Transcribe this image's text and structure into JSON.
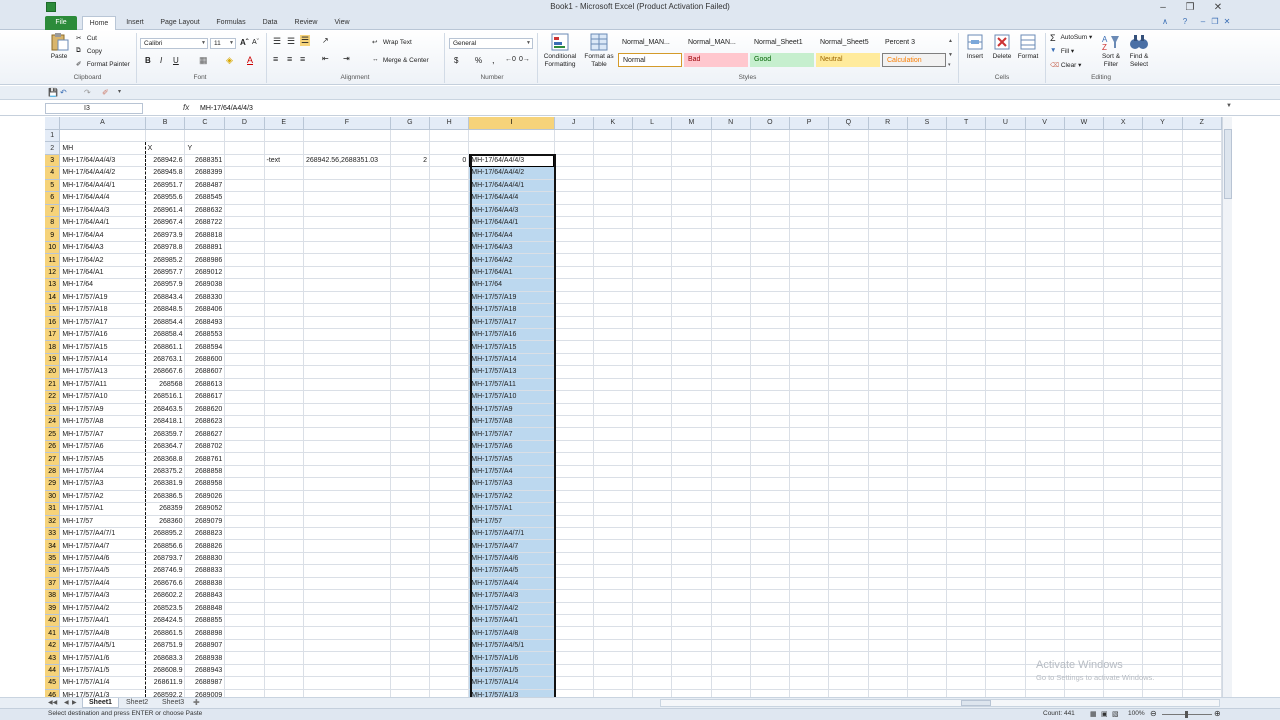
{
  "window": {
    "title": "Book1 - Microsoft Excel (Product Activation Failed)"
  },
  "ribbon_tabs": [
    "File",
    "Home",
    "Insert",
    "Page Layout",
    "Formulas",
    "Data",
    "Review",
    "View"
  ],
  "clipboard": {
    "paste": "Paste",
    "cut": "Cut",
    "copy": "Copy",
    "format_painter": "Format Painter",
    "label": "Clipboard"
  },
  "font": {
    "name": "Calibri",
    "size": "11",
    "bold": "B",
    "italic": "I",
    "underline": "U",
    "label": "Font"
  },
  "alignment": {
    "wrap_text": "Wrap Text",
    "merge_center": "Merge & Center",
    "label": "Alignment"
  },
  "number": {
    "format": "General",
    "currency": "$",
    "percent": "%",
    "comma": ",",
    "label": "Number"
  },
  "styles": {
    "conditional_formatting": "Conditional Formatting",
    "format_as_table": "Format as Table",
    "names": [
      "Normal_MAN...",
      "Normal_MAN...",
      "Normal_Sheet1",
      "Normal_Sheet5",
      "Percent 3"
    ],
    "boxes": [
      {
        "label": "Normal",
        "bg": "#ffffff",
        "fg": "#000000"
      },
      {
        "label": "Bad",
        "bg": "#ffc7ce",
        "fg": "#9c0006"
      },
      {
        "label": "Good",
        "bg": "#c6efce",
        "fg": "#006100"
      },
      {
        "label": "Neutral",
        "bg": "#ffeb9c",
        "fg": "#9c6500"
      },
      {
        "label": "Calculation",
        "bg": "#f2f2f2",
        "fg": "#fa7d00"
      }
    ],
    "label": "Styles"
  },
  "cells_group": {
    "insert": "Insert",
    "delete": "Delete",
    "format": "Format",
    "label": "Cells"
  },
  "editing": {
    "autosum": "AutoSum",
    "fill": "Fill",
    "clear": "Clear",
    "sort_filter": "Sort & Filter",
    "find_select": "Find & Select",
    "label": "Editing"
  },
  "formula_bar": {
    "name_box": "I3",
    "fx": "fx",
    "content": "MH-17/64/A4/4/3"
  },
  "columns": [
    "A",
    "B",
    "C",
    "D",
    "E",
    "F",
    "G",
    "H",
    "I",
    "J",
    "K",
    "L",
    "M",
    "N",
    "O",
    "P",
    "Q",
    "R",
    "S",
    "T",
    "U",
    "V",
    "W",
    "X",
    "Y",
    "Z"
  ],
  "header_row": {
    "A": "MH",
    "B": "X",
    "C": "Y"
  },
  "row3_extra": {
    "E": "-text",
    "F": "268942.56,2688351.03",
    "G": "2",
    "H": "0"
  },
  "rows": [
    [
      "MH-17/64/A4/4/3",
      "268942.6",
      "2688351",
      "MH-17/64/A4/4/3"
    ],
    [
      "MH-17/64/A4/4/2",
      "268945.8",
      "2688399",
      "MH-17/64/A4/4/2"
    ],
    [
      "MH-17/64/A4/4/1",
      "268951.7",
      "2688487",
      "MH-17/64/A4/4/1"
    ],
    [
      "MH-17/64/A4/4",
      "268955.6",
      "2688545",
      "MH-17/64/A4/4"
    ],
    [
      "MH-17/64/A4/3",
      "268961.4",
      "2688632",
      "MH-17/64/A4/3"
    ],
    [
      "MH-17/64/A4/1",
      "268967.4",
      "2688722",
      "MH-17/64/A4/1"
    ],
    [
      "MH-17/64/A4",
      "268973.9",
      "2688818",
      "MH-17/64/A4"
    ],
    [
      "MH-17/64/A3",
      "268978.8",
      "2688891",
      "MH-17/64/A3"
    ],
    [
      "MH-17/64/A2",
      "268985.2",
      "2688986",
      "MH-17/64/A2"
    ],
    [
      "MH-17/64/A1",
      "268957.7",
      "2689012",
      "MH-17/64/A1"
    ],
    [
      "MH-17/64",
      "268957.9",
      "2689038",
      "MH-17/64"
    ],
    [
      "MH-17/57/A19",
      "268843.4",
      "2688330",
      "MH-17/57/A19"
    ],
    [
      "MH-17/57/A18",
      "268848.5",
      "2688406",
      "MH-17/57/A18"
    ],
    [
      "MH-17/57/A17",
      "268854.4",
      "2688493",
      "MH-17/57/A17"
    ],
    [
      "MH-17/57/A16",
      "268858.4",
      "2688553",
      "MH-17/57/A16"
    ],
    [
      "MH-17/57/A15",
      "268861.1",
      "2688594",
      "MH-17/57/A15"
    ],
    [
      "MH-17/57/A14",
      "268763.1",
      "2688600",
      "MH-17/57/A14"
    ],
    [
      "MH-17/57/A13",
      "268667.6",
      "2688607",
      "MH-17/57/A13"
    ],
    [
      "MH-17/57/A11",
      "268568",
      "2688613",
      "MH-17/57/A11"
    ],
    [
      "MH-17/57/A10",
      "268516.1",
      "2688617",
      "MH-17/57/A10"
    ],
    [
      "MH-17/57/A9",
      "268463.5",
      "2688620",
      "MH-17/57/A9"
    ],
    [
      "MH-17/57/A8",
      "268418.1",
      "2688623",
      "MH-17/57/A8"
    ],
    [
      "MH-17/57/A7",
      "268359.7",
      "2688627",
      "MH-17/57/A7"
    ],
    [
      "MH-17/57/A6",
      "268364.7",
      "2688702",
      "MH-17/57/A6"
    ],
    [
      "MH-17/57/A5",
      "268368.8",
      "2688761",
      "MH-17/57/A5"
    ],
    [
      "MH-17/57/A4",
      "268375.2",
      "2688858",
      "MH-17/57/A4"
    ],
    [
      "MH-17/57/A3",
      "268381.9",
      "2688958",
      "MH-17/57/A3"
    ],
    [
      "MH-17/57/A2",
      "268386.5",
      "2689026",
      "MH-17/57/A2"
    ],
    [
      "MH-17/57/A1",
      "268359",
      "2689052",
      "MH-17/57/A1"
    ],
    [
      "MH-17/57",
      "268360",
      "2689079",
      "MH-17/57"
    ],
    [
      "MH-17/57/A4/7/1",
      "268895.2",
      "2688823",
      "MH-17/57/A4/7/1"
    ],
    [
      "MH-17/57/A4/7",
      "268856.6",
      "2688826",
      "MH-17/57/A4/7"
    ],
    [
      "MH-17/57/A4/6",
      "268793.7",
      "2688830",
      "MH-17/57/A4/6"
    ],
    [
      "MH-17/57/A4/5",
      "268746.9",
      "2688833",
      "MH-17/57/A4/5"
    ],
    [
      "MH-17/57/A4/4",
      "268676.6",
      "2688838",
      "MH-17/57/A4/4"
    ],
    [
      "MH-17/57/A4/3",
      "268602.2",
      "2688843",
      "MH-17/57/A4/3"
    ],
    [
      "MH-17/57/A4/2",
      "268523.5",
      "2688848",
      "MH-17/57/A4/2"
    ],
    [
      "MH-17/57/A4/1",
      "268424.5",
      "2688855",
      "MH-17/57/A4/1"
    ],
    [
      "MH-17/57/A4/8",
      "268861.5",
      "2688898",
      "MH-17/57/A4/8"
    ],
    [
      "MH-17/57/A4/5/1",
      "268751.9",
      "2688907",
      "MH-17/57/A4/5/1"
    ],
    [
      "MH-17/57/A1/6",
      "268683.3",
      "2688938",
      "MH-17/57/A1/6"
    ],
    [
      "MH-17/57/A1/5",
      "268608.9",
      "2688943",
      "MH-17/57/A1/5"
    ],
    [
      "MH-17/57/A1/4",
      "268611.9",
      "2688987",
      "MH-17/57/A1/4"
    ],
    [
      "MH-17/57/A1/3",
      "268592.2",
      "2689009",
      "MH-17/57/A1/3"
    ]
  ],
  "sheets": [
    "Sheet1",
    "Sheet2",
    "Sheet3"
  ],
  "status": {
    "message": "Select destination and press ENTER or choose Paste",
    "count": "Count: 441",
    "zoom": "100%"
  },
  "watermark": {
    "title": "Activate Windows",
    "subtitle": "Go to Settings to activate Windows."
  },
  "colors": {
    "selection": "#bcd8ef",
    "header_highlight": "#f6d37a",
    "file_tab": "#2c8b3a"
  }
}
